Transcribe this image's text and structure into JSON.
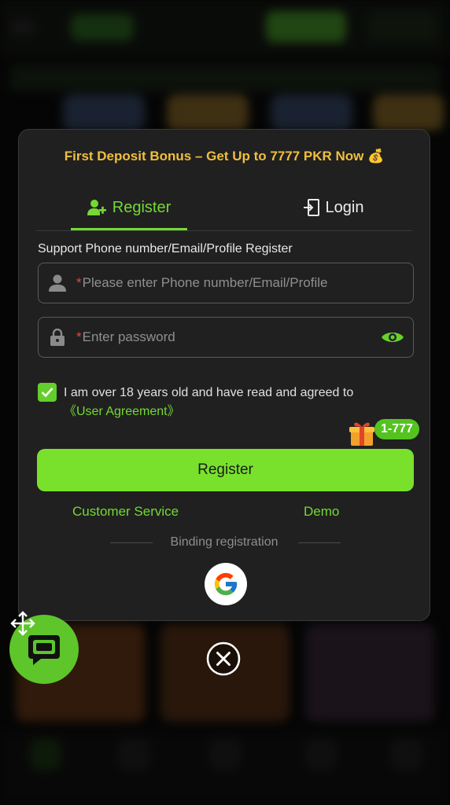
{
  "modal": {
    "promo": "First Deposit Bonus – Get Up to 7777 PKR Now 💰",
    "tabs": {
      "register": "Register",
      "login": "Login"
    },
    "support_text": "Support Phone number/Email/Profile Register",
    "phone_field": {
      "required_mark": "*",
      "placeholder": "Please enter Phone number/Email/Profile"
    },
    "password_field": {
      "required_mark": "*",
      "placeholder": "Enter password"
    },
    "agreement": {
      "checked": true,
      "text": "I am over 18 years old and have read and agreed to",
      "link": "《User Agreement》"
    },
    "bonus_badge": "1-777",
    "register_button": "Register",
    "links": {
      "customer_service": "Customer Service",
      "demo": "Demo"
    },
    "binding_label": "Binding registration"
  },
  "colors": {
    "accent": "#74d933",
    "button": "#79e12c",
    "promo": "#f0bf3c",
    "required": "#e04b3c",
    "modal_bg": "#202020"
  },
  "icons": {
    "register_tab": "user-add-icon",
    "login_tab": "login-door-icon",
    "phone_field": "user-icon",
    "password_field": "lock-icon",
    "password_toggle": "eye-icon",
    "checkbox": "checkmark-icon",
    "bonus": "gift-icon",
    "social": "google-icon",
    "close": "close-circle-icon",
    "chat": "chat-bubble-icon",
    "drag": "move-arrows-icon"
  }
}
